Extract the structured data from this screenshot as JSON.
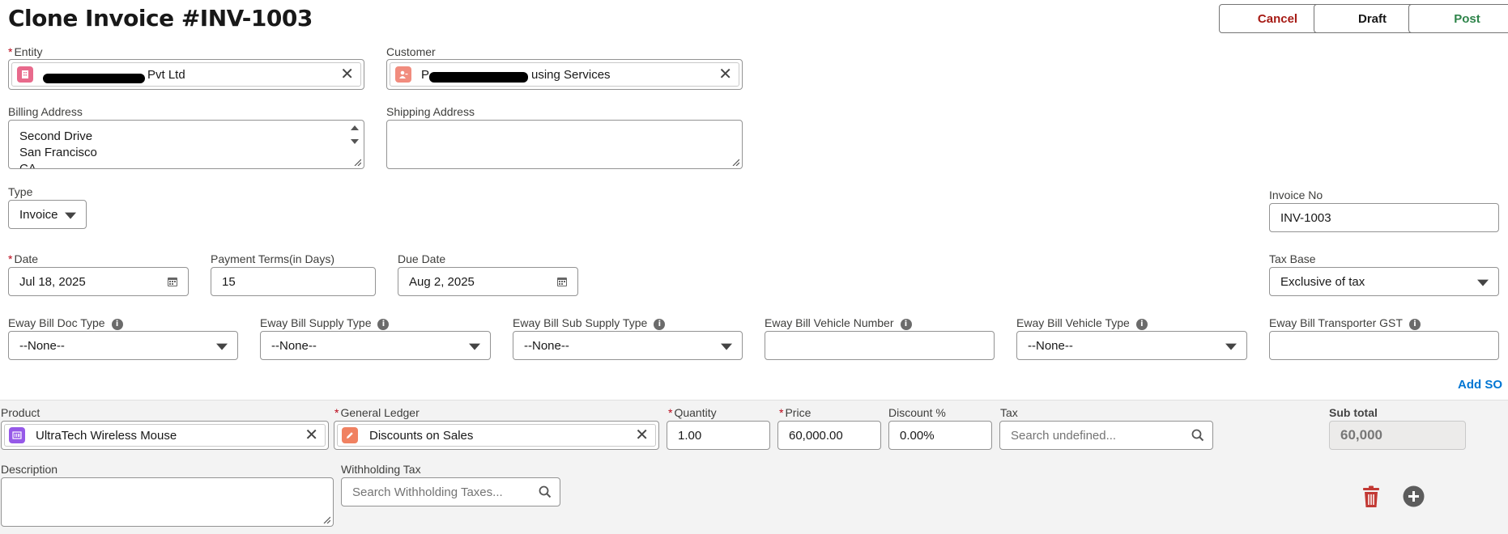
{
  "header": {
    "title": "Clone Invoice #INV-1003",
    "cancel_label": "Cancel",
    "draft_label": "Draft",
    "post_label": "Post"
  },
  "entity": {
    "label": "Entity",
    "value": "Pvt Ltd"
  },
  "customer": {
    "label": "Customer",
    "value_prefix": "P",
    "value": "using Services"
  },
  "billing_address": {
    "label": "Billing Address",
    "lines": [
      "Second Drive",
      "San Francisco",
      "CA"
    ]
  },
  "shipping_address": {
    "label": "Shipping Address",
    "value": ""
  },
  "type": {
    "label": "Type",
    "value": "Invoice"
  },
  "invoice_no": {
    "label": "Invoice No",
    "value": "INV-1003"
  },
  "date": {
    "label": "Date",
    "value": "Jul 18, 2025"
  },
  "payment_terms": {
    "label": "Payment Terms(in Days)",
    "value": "15"
  },
  "due_date": {
    "label": "Due Date",
    "value": "Aug 2, 2025"
  },
  "tax_base": {
    "label": "Tax Base",
    "value": "Exclusive of tax"
  },
  "eway": {
    "doc_type": {
      "label": "Eway Bill Doc Type",
      "value": "--None--"
    },
    "supply_type": {
      "label": "Eway Bill Supply Type",
      "value": "--None--"
    },
    "sub_supply_type": {
      "label": "Eway Bill Sub Supply Type",
      "value": "--None--"
    },
    "vehicle_number": {
      "label": "Eway Bill Vehicle Number",
      "value": ""
    },
    "vehicle_type": {
      "label": "Eway Bill Vehicle Type",
      "value": "--None--"
    },
    "transporter_gst": {
      "label": "Eway Bill Transporter GST",
      "value": ""
    }
  },
  "add_so_label": "Add SO",
  "line_item": {
    "product": {
      "label": "Product",
      "value": "UltraTech Wireless Mouse"
    },
    "general_ledger": {
      "label": "General Ledger",
      "value": "Discounts on Sales"
    },
    "quantity": {
      "label": "Quantity",
      "value": "1.00"
    },
    "price": {
      "label": "Price",
      "value": "60,000.00"
    },
    "discount": {
      "label": "Discount %",
      "value": "0.00%"
    },
    "tax": {
      "label": "Tax",
      "placeholder": "Search undefined..."
    },
    "sub_total": {
      "label": "Sub total",
      "value": "60,000"
    },
    "description": {
      "label": "Description",
      "value": ""
    },
    "withholding_tax": {
      "label": "Withholding Tax",
      "placeholder": "Search Withholding Taxes..."
    }
  },
  "colors": {
    "cancel": "#a61a14",
    "post": "#2e844a",
    "link": "#0176d3",
    "entity_chip": "#e86a8c",
    "customer_chip": "#f18c7e",
    "product_chip": "#9659e8",
    "ledger_chip": "#f08161",
    "delete": "#c23934"
  }
}
